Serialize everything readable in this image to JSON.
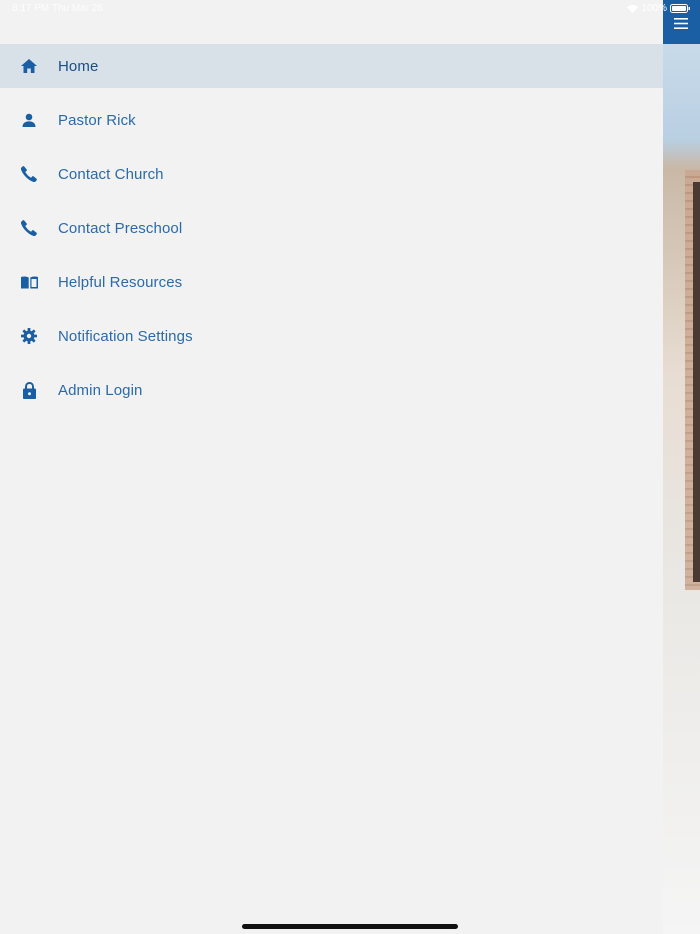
{
  "status_bar": {
    "time_date": "8:17 PM   Thu Mar 26",
    "battery_percent": "100%"
  },
  "colors": {
    "accent": "#1a5ea3",
    "menu_text": "#2b6aa8",
    "active_bg": "#d8e0e8",
    "drawer_bg": "#f2f2f2"
  },
  "menu": {
    "items": [
      {
        "label": "Home",
        "icon": "home-icon",
        "active": true
      },
      {
        "label": "Pastor Rick",
        "icon": "person-icon",
        "active": false
      },
      {
        "label": "Contact Church",
        "icon": "phone-icon",
        "active": false
      },
      {
        "label": "Contact Preschool",
        "icon": "phone-icon",
        "active": false
      },
      {
        "label": "Helpful Resources",
        "icon": "book-icon",
        "active": false
      },
      {
        "label": "Notification Settings",
        "icon": "gear-icon",
        "active": false
      },
      {
        "label": "Admin Login",
        "icon": "lock-icon",
        "active": false
      }
    ]
  }
}
